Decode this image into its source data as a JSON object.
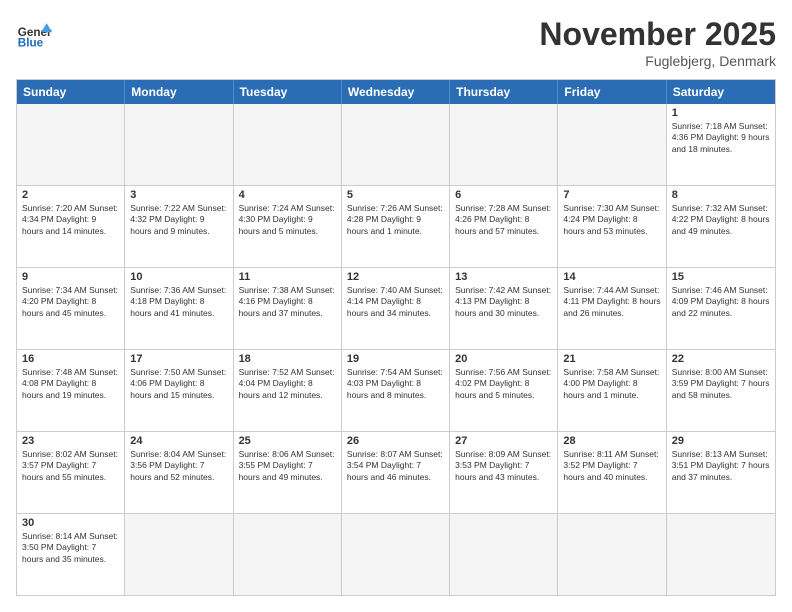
{
  "header": {
    "logo_general": "General",
    "logo_blue": "Blue",
    "month_title": "November 2025",
    "location": "Fuglebjerg, Denmark"
  },
  "days_of_week": [
    "Sunday",
    "Monday",
    "Tuesday",
    "Wednesday",
    "Thursday",
    "Friday",
    "Saturday"
  ],
  "rows": [
    [
      {
        "day": "",
        "info": "",
        "empty": true
      },
      {
        "day": "",
        "info": "",
        "empty": true
      },
      {
        "day": "",
        "info": "",
        "empty": true
      },
      {
        "day": "",
        "info": "",
        "empty": true
      },
      {
        "day": "",
        "info": "",
        "empty": true
      },
      {
        "day": "",
        "info": "",
        "empty": true
      },
      {
        "day": "1",
        "info": "Sunrise: 7:18 AM\nSunset: 4:36 PM\nDaylight: 9 hours and 18 minutes."
      }
    ],
    [
      {
        "day": "2",
        "info": "Sunrise: 7:20 AM\nSunset: 4:34 PM\nDaylight: 9 hours and 14 minutes."
      },
      {
        "day": "3",
        "info": "Sunrise: 7:22 AM\nSunset: 4:32 PM\nDaylight: 9 hours and 9 minutes."
      },
      {
        "day": "4",
        "info": "Sunrise: 7:24 AM\nSunset: 4:30 PM\nDaylight: 9 hours and 5 minutes."
      },
      {
        "day": "5",
        "info": "Sunrise: 7:26 AM\nSunset: 4:28 PM\nDaylight: 9 hours and 1 minute."
      },
      {
        "day": "6",
        "info": "Sunrise: 7:28 AM\nSunset: 4:26 PM\nDaylight: 8 hours and 57 minutes."
      },
      {
        "day": "7",
        "info": "Sunrise: 7:30 AM\nSunset: 4:24 PM\nDaylight: 8 hours and 53 minutes."
      },
      {
        "day": "8",
        "info": "Sunrise: 7:32 AM\nSunset: 4:22 PM\nDaylight: 8 hours and 49 minutes."
      }
    ],
    [
      {
        "day": "9",
        "info": "Sunrise: 7:34 AM\nSunset: 4:20 PM\nDaylight: 8 hours and 45 minutes."
      },
      {
        "day": "10",
        "info": "Sunrise: 7:36 AM\nSunset: 4:18 PM\nDaylight: 8 hours and 41 minutes."
      },
      {
        "day": "11",
        "info": "Sunrise: 7:38 AM\nSunset: 4:16 PM\nDaylight: 8 hours and 37 minutes."
      },
      {
        "day": "12",
        "info": "Sunrise: 7:40 AM\nSunset: 4:14 PM\nDaylight: 8 hours and 34 minutes."
      },
      {
        "day": "13",
        "info": "Sunrise: 7:42 AM\nSunset: 4:13 PM\nDaylight: 8 hours and 30 minutes."
      },
      {
        "day": "14",
        "info": "Sunrise: 7:44 AM\nSunset: 4:11 PM\nDaylight: 8 hours and 26 minutes."
      },
      {
        "day": "15",
        "info": "Sunrise: 7:46 AM\nSunset: 4:09 PM\nDaylight: 8 hours and 22 minutes."
      }
    ],
    [
      {
        "day": "16",
        "info": "Sunrise: 7:48 AM\nSunset: 4:08 PM\nDaylight: 8 hours and 19 minutes."
      },
      {
        "day": "17",
        "info": "Sunrise: 7:50 AM\nSunset: 4:06 PM\nDaylight: 8 hours and 15 minutes."
      },
      {
        "day": "18",
        "info": "Sunrise: 7:52 AM\nSunset: 4:04 PM\nDaylight: 8 hours and 12 minutes."
      },
      {
        "day": "19",
        "info": "Sunrise: 7:54 AM\nSunset: 4:03 PM\nDaylight: 8 hours and 8 minutes."
      },
      {
        "day": "20",
        "info": "Sunrise: 7:56 AM\nSunset: 4:02 PM\nDaylight: 8 hours and 5 minutes."
      },
      {
        "day": "21",
        "info": "Sunrise: 7:58 AM\nSunset: 4:00 PM\nDaylight: 8 hours and 1 minute."
      },
      {
        "day": "22",
        "info": "Sunrise: 8:00 AM\nSunset: 3:59 PM\nDaylight: 7 hours and 58 minutes."
      }
    ],
    [
      {
        "day": "23",
        "info": "Sunrise: 8:02 AM\nSunset: 3:57 PM\nDaylight: 7 hours and 55 minutes."
      },
      {
        "day": "24",
        "info": "Sunrise: 8:04 AM\nSunset: 3:56 PM\nDaylight: 7 hours and 52 minutes."
      },
      {
        "day": "25",
        "info": "Sunrise: 8:06 AM\nSunset: 3:55 PM\nDaylight: 7 hours and 49 minutes."
      },
      {
        "day": "26",
        "info": "Sunrise: 8:07 AM\nSunset: 3:54 PM\nDaylight: 7 hours and 46 minutes."
      },
      {
        "day": "27",
        "info": "Sunrise: 8:09 AM\nSunset: 3:53 PM\nDaylight: 7 hours and 43 minutes."
      },
      {
        "day": "28",
        "info": "Sunrise: 8:11 AM\nSunset: 3:52 PM\nDaylight: 7 hours and 40 minutes."
      },
      {
        "day": "29",
        "info": "Sunrise: 8:13 AM\nSunset: 3:51 PM\nDaylight: 7 hours and 37 minutes."
      }
    ],
    [
      {
        "day": "30",
        "info": "Sunrise: 8:14 AM\nSunset: 3:50 PM\nDaylight: 7 hours and 35 minutes."
      },
      {
        "day": "",
        "info": "",
        "empty": true
      },
      {
        "day": "",
        "info": "",
        "empty": true
      },
      {
        "day": "",
        "info": "",
        "empty": true
      },
      {
        "day": "",
        "info": "",
        "empty": true
      },
      {
        "day": "",
        "info": "",
        "empty": true
      },
      {
        "day": "",
        "info": "",
        "empty": true
      }
    ]
  ]
}
